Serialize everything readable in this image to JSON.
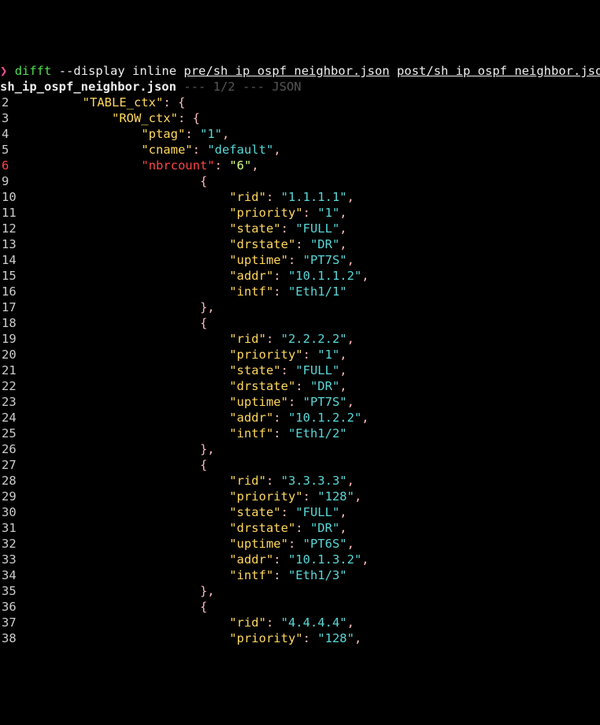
{
  "cmd": {
    "prompt": "❯",
    "name": "difft",
    "flag": "--display",
    "mode": "inline",
    "file_a": "pre/sh ip ospf neighbor.json",
    "file_b": "post/sh ip ospf neighbor.json"
  },
  "header": {
    "filename": "sh_ip_ospf_neighbor.json",
    "sep1": "---",
    "counter": "1/2",
    "sep2": "---",
    "lang": "JSON"
  },
  "rows": [
    {
      "n": "2",
      "indent": 8,
      "key": "TABLE_ctx",
      "after": ": {"
    },
    {
      "n": "3",
      "indent": 12,
      "key": "ROW_ctx",
      "after": ": {"
    },
    {
      "n": "4",
      "indent": 16,
      "key": "ptag",
      "val": "1",
      "comma": true
    },
    {
      "n": "5",
      "indent": 16,
      "key": "cname",
      "val": "default",
      "comma": true
    },
    {
      "n": "6",
      "indent": 16,
      "key": "nbrcount",
      "val": "6",
      "comma": true,
      "changed": true
    },
    {
      "n": "9",
      "indent": 24,
      "raw": "{"
    },
    {
      "n": "10",
      "indent": 28,
      "key": "rid",
      "val": "1.1.1.1",
      "comma": true
    },
    {
      "n": "11",
      "indent": 28,
      "key": "priority",
      "val": "1",
      "comma": true
    },
    {
      "n": "12",
      "indent": 28,
      "key": "state",
      "val": "FULL",
      "comma": true
    },
    {
      "n": "13",
      "indent": 28,
      "key": "drstate",
      "val": "DR",
      "comma": true
    },
    {
      "n": "14",
      "indent": 28,
      "key": "uptime",
      "val": "PT7S",
      "comma": true
    },
    {
      "n": "15",
      "indent": 28,
      "key": "addr",
      "val": "10.1.1.2",
      "comma": true
    },
    {
      "n": "16",
      "indent": 28,
      "key": "intf",
      "val": "Eth1/1"
    },
    {
      "n": "17",
      "indent": 24,
      "raw": "},"
    },
    {
      "n": "18",
      "indent": 24,
      "raw": "{"
    },
    {
      "n": "19",
      "indent": 28,
      "key": "rid",
      "val": "2.2.2.2",
      "comma": true
    },
    {
      "n": "20",
      "indent": 28,
      "key": "priority",
      "val": "1",
      "comma": true
    },
    {
      "n": "21",
      "indent": 28,
      "key": "state",
      "val": "FULL",
      "comma": true
    },
    {
      "n": "22",
      "indent": 28,
      "key": "drstate",
      "val": "DR",
      "comma": true
    },
    {
      "n": "23",
      "indent": 28,
      "key": "uptime",
      "val": "PT7S",
      "comma": true
    },
    {
      "n": "24",
      "indent": 28,
      "key": "addr",
      "val": "10.1.2.2",
      "comma": true
    },
    {
      "n": "25",
      "indent": 28,
      "key": "intf",
      "val": "Eth1/2"
    },
    {
      "n": "26",
      "indent": 24,
      "raw": "},"
    },
    {
      "n": "27",
      "indent": 24,
      "raw": "{"
    },
    {
      "n": "28",
      "indent": 28,
      "key": "rid",
      "val": "3.3.3.3",
      "comma": true
    },
    {
      "n": "29",
      "indent": 28,
      "key": "priority",
      "val": "128",
      "comma": true
    },
    {
      "n": "30",
      "indent": 28,
      "key": "state",
      "val": "FULL",
      "comma": true
    },
    {
      "n": "31",
      "indent": 28,
      "key": "drstate",
      "val": "DR",
      "comma": true
    },
    {
      "n": "32",
      "indent": 28,
      "key": "uptime",
      "val": "PT6S",
      "comma": true
    },
    {
      "n": "33",
      "indent": 28,
      "key": "addr",
      "val": "10.1.3.2",
      "comma": true
    },
    {
      "n": "34",
      "indent": 28,
      "key": "intf",
      "val": "Eth1/3"
    },
    {
      "n": "35",
      "indent": 24,
      "raw": "},"
    },
    {
      "n": "36",
      "indent": 24,
      "raw": "{"
    },
    {
      "n": "37",
      "indent": 28,
      "key": "rid",
      "val": "4.4.4.4",
      "comma": true
    },
    {
      "n": "38",
      "indent": 28,
      "key": "priority",
      "val": "128",
      "comma": true
    }
  ]
}
